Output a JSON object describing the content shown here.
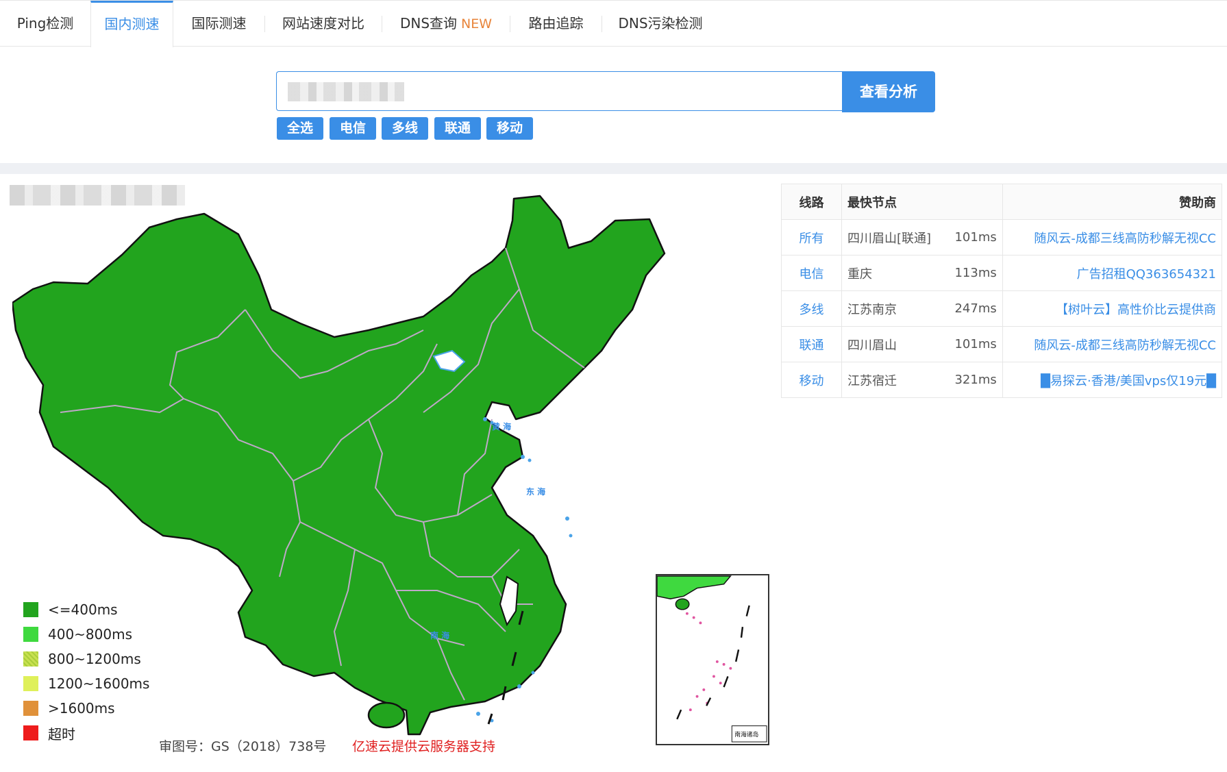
{
  "tabs": [
    {
      "label": "Ping检测",
      "badge": ""
    },
    {
      "label": "国内测速",
      "badge": ""
    },
    {
      "label": "国际测速",
      "badge": ""
    },
    {
      "label": "网站速度对比",
      "badge": ""
    },
    {
      "label": "DNS查询",
      "badge": "NEW"
    },
    {
      "label": "路由追踪",
      "badge": ""
    },
    {
      "label": "DNS污染检测",
      "badge": ""
    }
  ],
  "search": {
    "button_label": "查看分析"
  },
  "filters": [
    "全选",
    "电信",
    "多线",
    "联通",
    "移动"
  ],
  "table": {
    "headers": {
      "line": "线路",
      "node": "最快节点",
      "sponsor": "赞助商"
    },
    "rows": [
      {
        "line": "所有",
        "node": "四川眉山[联通]",
        "ms": "101ms",
        "sponsor": "随风云-成都三线高防秒解无视CC"
      },
      {
        "line": "电信",
        "node": "重庆",
        "ms": "113ms",
        "sponsor": "广告招租QQ363654321"
      },
      {
        "line": "多线",
        "node": "江苏南京",
        "ms": "247ms",
        "sponsor": "【树叶云】高性价比云提供商"
      },
      {
        "line": "联通",
        "node": "四川眉山",
        "ms": "101ms",
        "sponsor": "随风云-成都三线高防秒解无视CC"
      },
      {
        "line": "移动",
        "node": "江苏宿迁",
        "ms": "321ms",
        "sponsor": "█易探云·香港/美国vps仅19元█"
      }
    ]
  },
  "legend": [
    {
      "label": "<=400ms",
      "color": "#22a41e"
    },
    {
      "label": "400~800ms",
      "color": "#3fd93f"
    },
    {
      "label": "800~1200ms",
      "color": "#c8e050"
    },
    {
      "label": "1200~1600ms",
      "color": "#dff05a"
    },
    {
      "label": ">1600ms",
      "color": "#e0913a"
    },
    {
      "label": "超时",
      "color": "#ee1c1c"
    }
  ],
  "map": {
    "fill_color": "#22a41e",
    "sea_labels": [
      "黄 海",
      "东 海",
      "南 海"
    ],
    "inset_label": "南海诸岛"
  },
  "footer": {
    "approval": "审图号：GS（2018）738号",
    "support": "亿速云提供云服务器支持"
  }
}
